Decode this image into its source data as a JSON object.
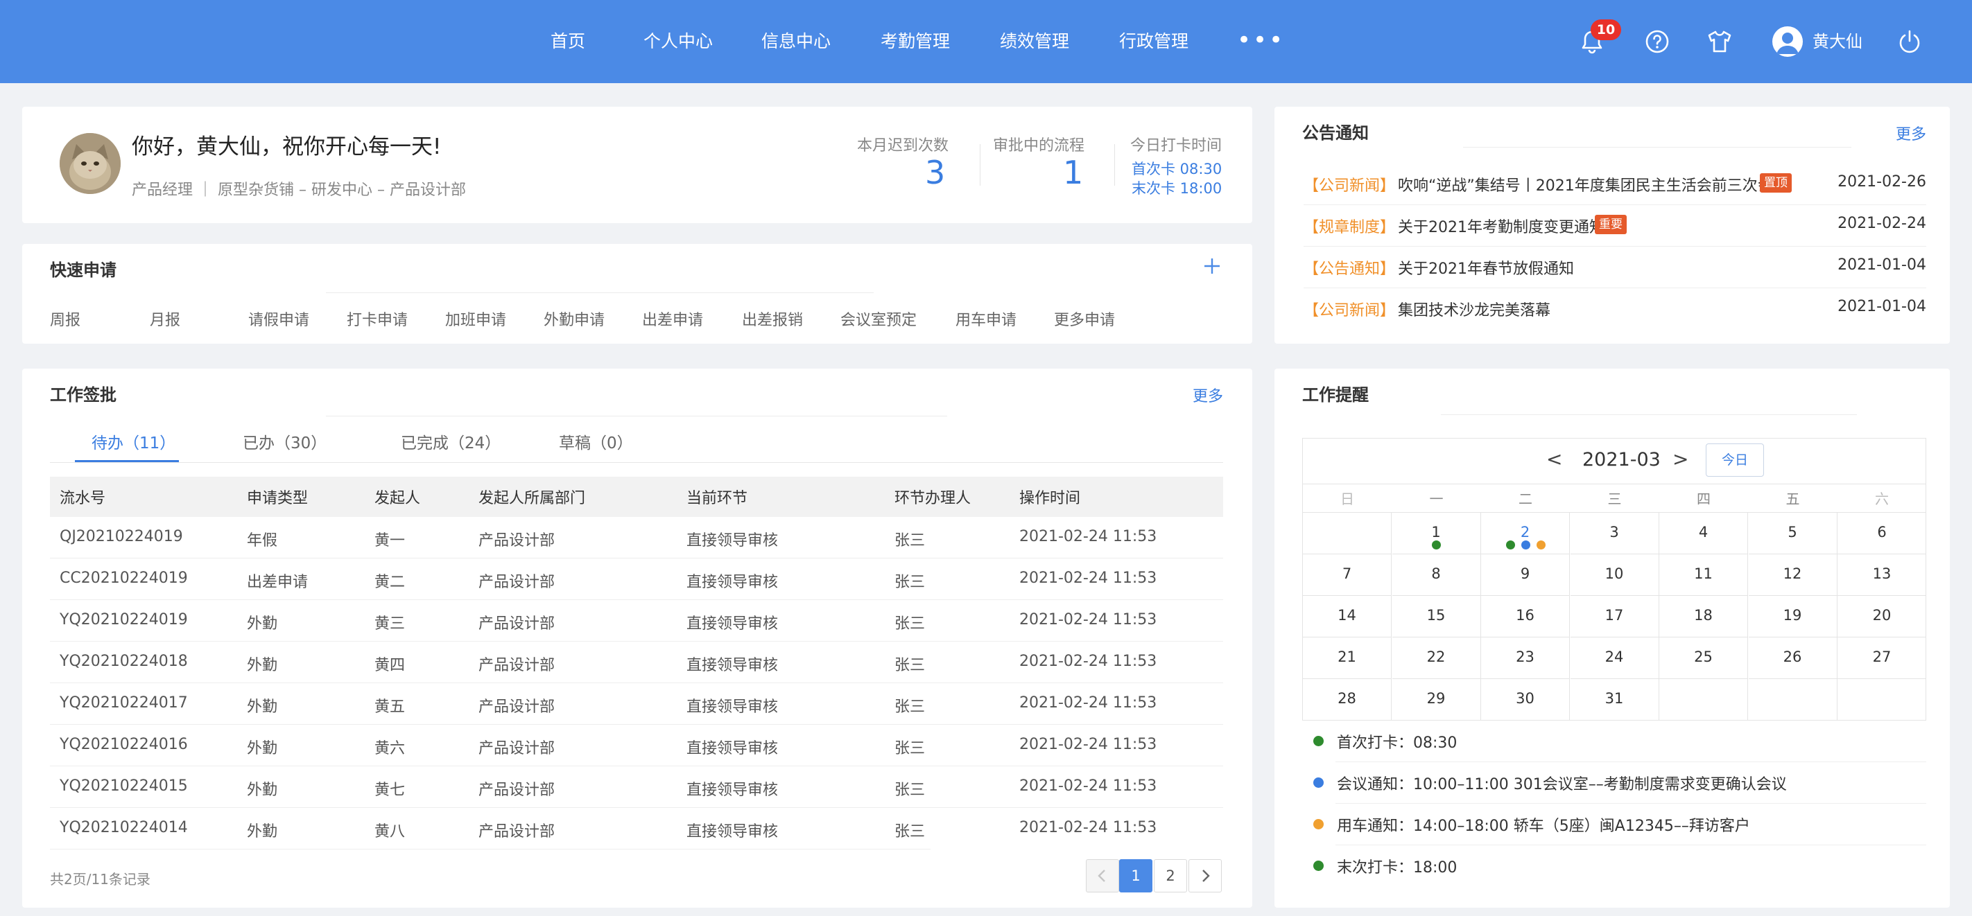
{
  "nav": {
    "items": [
      "首页",
      "个人中心",
      "信息中心",
      "考勤管理",
      "绩效管理",
      "行政管理"
    ],
    "more": "•••",
    "notification_count": "10",
    "username": "黄大仙"
  },
  "profile": {
    "greeting": "你好，黄大仙，祝你开心每一天!",
    "org": "产品经理 ｜ 原型杂货铺 – 研发中心 – 产品设计部",
    "late_label": "本月迟到次数",
    "late_value": "3",
    "approving_label": "审批中的流程",
    "approving_value": "1",
    "punch_label": "今日打卡时间",
    "first_punch": "首次卡   08:30",
    "last_punch": "末次卡   18:00"
  },
  "quick": {
    "title": "快速申请",
    "items": [
      "周报",
      "月报",
      "请假申请",
      "打卡申请",
      "加班申请",
      "外勤申请",
      "出差申请",
      "出差报销",
      "会议室预定",
      "用车申请",
      "更多申请"
    ]
  },
  "approval": {
    "title": "工作签批",
    "more": "更多",
    "tabs": [
      "待办（11）",
      "已办（30）",
      "已完成（24）",
      "草稿（0）"
    ],
    "columns": [
      "流水号",
      "申请类型",
      "发起人",
      "发起人所属部门",
      "当前环节",
      "环节办理人",
      "操作时间"
    ],
    "rows": [
      [
        "QJ20210224019",
        "年假",
        "黄一",
        "产品设计部",
        "直接领导审核",
        "张三",
        "2021-02-24 11:53"
      ],
      [
        "CC20210224019",
        "出差申请",
        "黄二",
        "产品设计部",
        "直接领导审核",
        "张三",
        "2021-02-24 11:53"
      ],
      [
        "YQ20210224019",
        "外勤",
        "黄三",
        "产品设计部",
        "直接领导审核",
        "张三",
        "2021-02-24 11:53"
      ],
      [
        "YQ20210224018",
        "外勤",
        "黄四",
        "产品设计部",
        "直接领导审核",
        "张三",
        "2021-02-24 11:53"
      ],
      [
        "YQ20210224017",
        "外勤",
        "黄五",
        "产品设计部",
        "直接领导审核",
        "张三",
        "2021-02-24 11:53"
      ],
      [
        "YQ20210224016",
        "外勤",
        "黄六",
        "产品设计部",
        "直接领导审核",
        "张三",
        "2021-02-24 11:53"
      ],
      [
        "YQ20210224015",
        "外勤",
        "黄七",
        "产品设计部",
        "直接领导审核",
        "张三",
        "2021-02-24 11:53"
      ],
      [
        "YQ20210224014",
        "外勤",
        "黄八",
        "产品设计部",
        "直接领导审核",
        "张三",
        "2021-02-24 11:53"
      ]
    ],
    "records": "共2页/11条记录",
    "pages": [
      "1",
      "2"
    ],
    "current_page": "1"
  },
  "notices": {
    "title": "公告通知",
    "more": "更多",
    "items": [
      {
        "tag": "【公司新闻】",
        "text": "吹响“逆战”集结号丨2021年度集团民主生活会前三次会议",
        "badge": "置顶",
        "date": "2021-02-26"
      },
      {
        "tag": "【规章制度】",
        "text": "关于2021年考勤制度变更通知",
        "badge": "重要",
        "date": "2021-02-24"
      },
      {
        "tag": "【公告通知】",
        "text": "关于2021年春节放假通知",
        "badge": "",
        "date": "2021-01-04"
      },
      {
        "tag": "【公司新闻】",
        "text": "集团技术沙龙完美落幕",
        "badge": "",
        "date": "2021-01-04"
      }
    ]
  },
  "reminder": {
    "title": "工作提醒",
    "month": "2021-03",
    "today_label": "今日",
    "prev": "<",
    "next": ">",
    "weekdays": [
      "日",
      "一",
      "二",
      "三",
      "四",
      "五",
      "六"
    ],
    "first_weekday": 1,
    "days_in_month": 31,
    "active_day": 2,
    "day_dots": {
      "1": [
        "#2e8b2e"
      ],
      "2": [
        "#2e8b2e",
        "#3a7de0",
        "#f0a030"
      ]
    },
    "items": [
      {
        "color": "#2e8b2e",
        "text": "首次打卡：08:30"
      },
      {
        "color": "#3a7de0",
        "text": "会议通知：10:00–11:00   301会议室––考勤制度需求变更确认会议"
      },
      {
        "color": "#f0a030",
        "text": "用车通知：14:00–18:00   轿车（5座）闽A12345––拜访客户"
      },
      {
        "color": "#2e8b2e",
        "text": "末次打卡：18:00"
      }
    ]
  },
  "colors": {
    "primary": "#4b8ae6",
    "accent": "#3a7de0",
    "tag": "#f0902a",
    "badge": "#e55a2b",
    "alert": "#e8302a"
  }
}
